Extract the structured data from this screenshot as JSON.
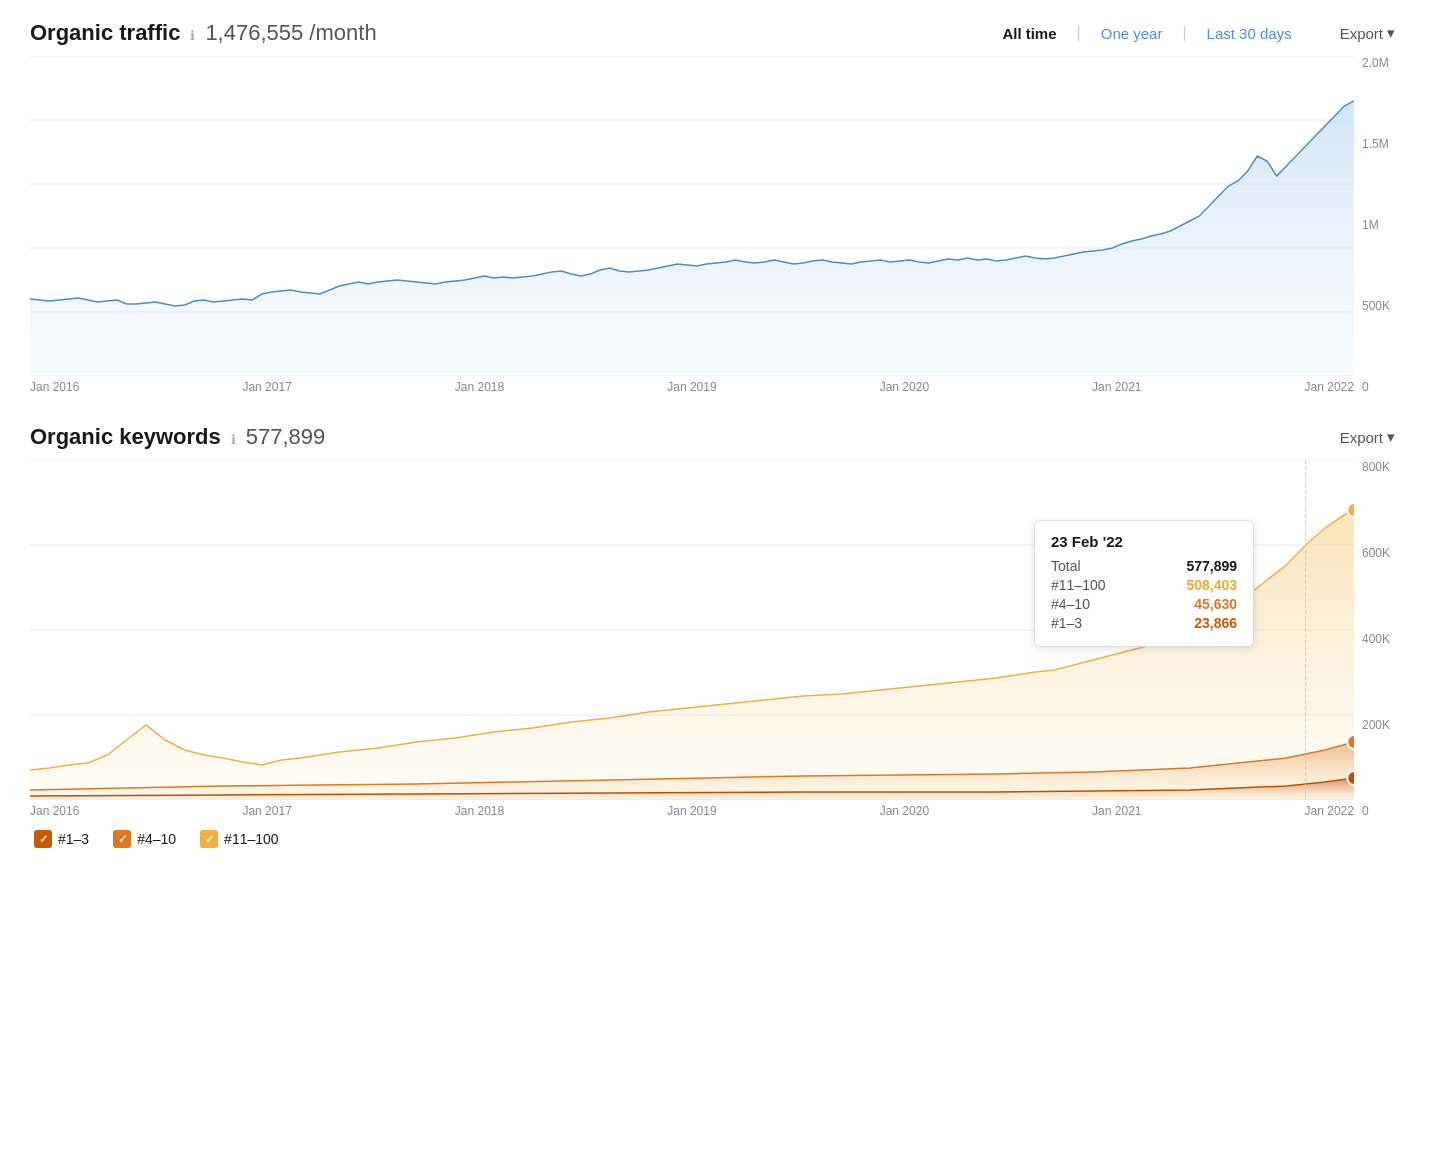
{
  "organic_traffic": {
    "title": "Organic traffic",
    "metric": "1,476,555 /month",
    "info_icon": "ℹ",
    "time_filters": [
      {
        "label": "All time",
        "active": true
      },
      {
        "label": "One year",
        "active": false
      },
      {
        "label": "Last 30 days",
        "active": false
      }
    ],
    "export_label": "Export",
    "y_axis": [
      "2.0M",
      "1.5M",
      "1M",
      "500K",
      "0"
    ],
    "x_axis": [
      "Jan 2016",
      "Jan 2017",
      "Jan 2018",
      "Jan 2019",
      "Jan 2020",
      "Jan 2021",
      "Jan 2022"
    ]
  },
  "organic_keywords": {
    "title": "Organic keywords",
    "metric": "577,899",
    "info_icon": "ℹ",
    "export_label": "Export",
    "y_axis": [
      "800K",
      "600K",
      "400K",
      "200K",
      "0"
    ],
    "x_axis": [
      "Jan 2016",
      "Jan 2017",
      "Jan 2018",
      "Jan 2019",
      "Jan 2020",
      "Jan 2021",
      "Jan 2022"
    ],
    "tooltip": {
      "date": "23 Feb '22",
      "rows": [
        {
          "label": "Total",
          "value": "577,899",
          "color": "black"
        },
        {
          "label": "#11–100",
          "value": "508,403",
          "color": "orange"
        },
        {
          "label": "#4–10",
          "value": "45,630",
          "color": "orange2"
        },
        {
          "label": "#1–3",
          "value": "23,866",
          "color": "orange3"
        }
      ]
    },
    "legend": [
      {
        "label": "#1–3"
      },
      {
        "label": "#4–10"
      },
      {
        "label": "#11–100"
      }
    ]
  },
  "icons": {
    "chevron_down": "▾",
    "check": "✓"
  }
}
